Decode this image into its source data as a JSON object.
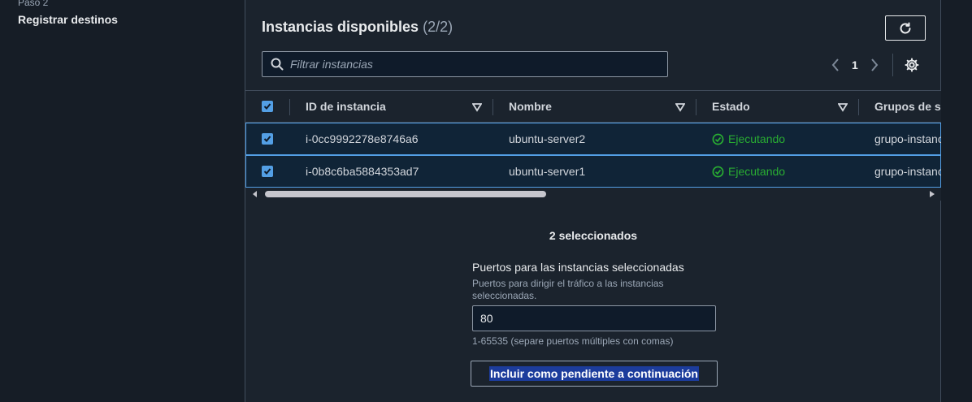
{
  "sidebar": {
    "step_label": "Paso 2",
    "step_title": "Registrar destinos"
  },
  "panel": {
    "title": "Instancias disponibles",
    "count": "(2/2)",
    "search_placeholder": "Filtrar instancias",
    "page": "1"
  },
  "table": {
    "columns": [
      "ID de instancia",
      "Nombre",
      "Estado",
      "Grupos de seguridad"
    ],
    "rows": [
      {
        "id": "i-0cc9992278e8746a6",
        "name": "ubuntu-server2",
        "status": "Ejecutando",
        "group": "grupo-instancias"
      },
      {
        "id": "i-0b8c6ba5884353ad7",
        "name": "ubuntu-server1",
        "status": "Ejecutando",
        "group": "grupo-instancias"
      }
    ]
  },
  "selection": {
    "summary": "2 seleccionados",
    "ports_label": "Puertos para las instancias seleccionadas",
    "ports_desc": "Puertos para dirigir el tráfico a las instancias seleccionadas.",
    "ports_value": "80",
    "ports_hint": "1-65535 (separe puertos múltiples con comas)",
    "include_label": "Incluir como pendiente a continuación"
  },
  "colors": {
    "accent": "#539fe5",
    "success": "#29ad32",
    "background": "#161d26",
    "panel": "#1b232d"
  },
  "icons": [
    "refresh-icon",
    "search-icon",
    "chevron-left-icon",
    "chevron-right-icon",
    "gear-icon",
    "sort-down-icon",
    "check-icon",
    "check-circle-icon"
  ]
}
